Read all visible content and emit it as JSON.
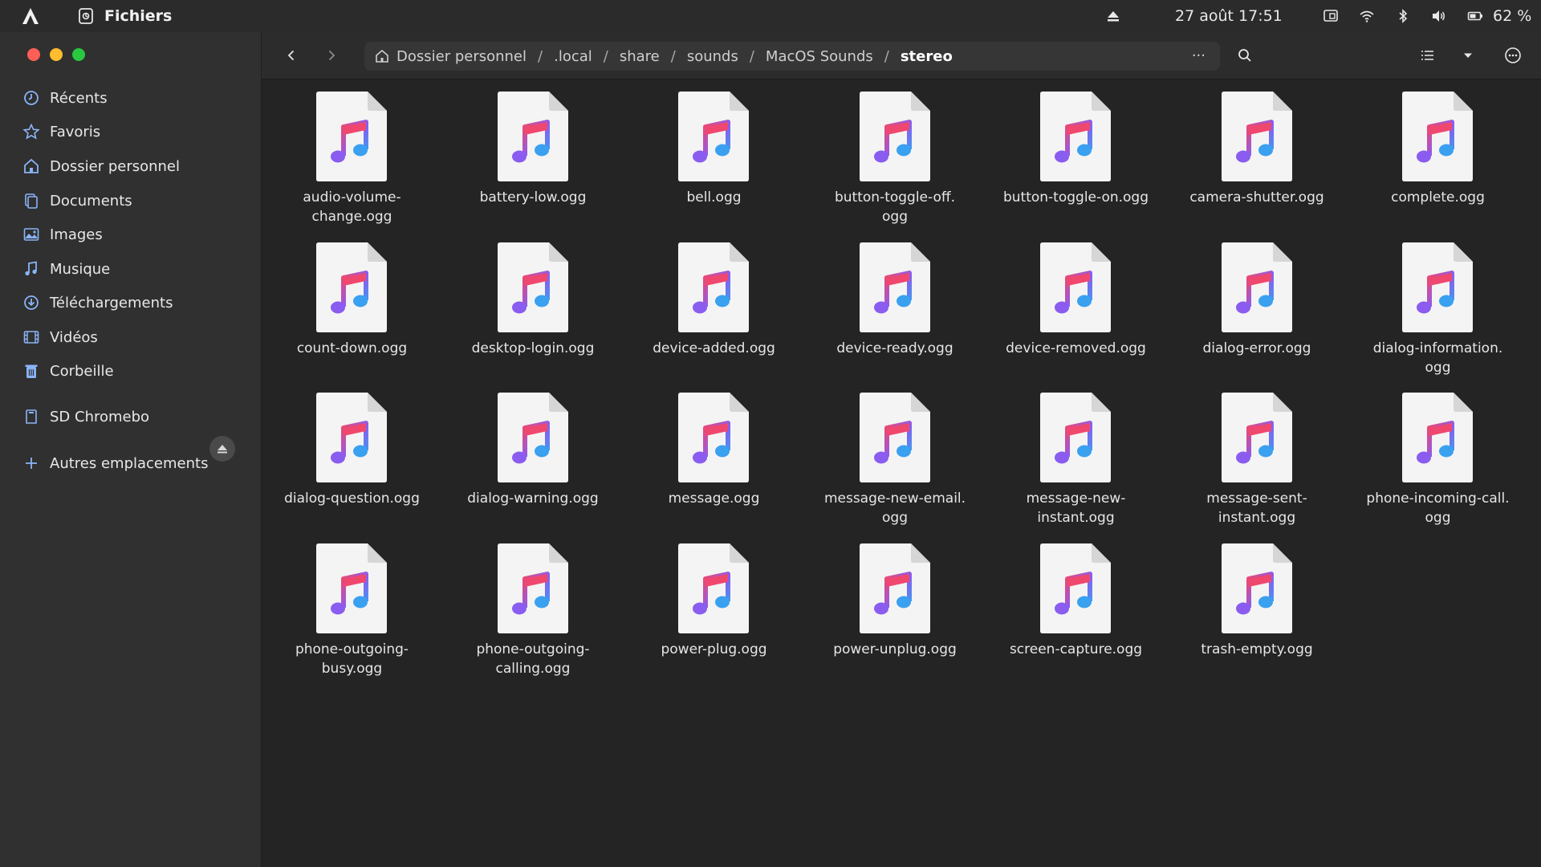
{
  "topbar": {
    "app_name": "Fichiers",
    "clock": "27 août  17:51",
    "battery": "62 %"
  },
  "sidebar": {
    "items": [
      {
        "label": "Récents",
        "icon": "clock-icon"
      },
      {
        "label": "Favoris",
        "icon": "star-icon"
      },
      {
        "label": "Dossier personnel",
        "icon": "home-icon"
      },
      {
        "label": "Documents",
        "icon": "document-icon"
      },
      {
        "label": "Images",
        "icon": "image-icon"
      },
      {
        "label": "Musique",
        "icon": "music-icon"
      },
      {
        "label": "Téléchargements",
        "icon": "download-icon"
      },
      {
        "label": "Vidéos",
        "icon": "film-icon"
      },
      {
        "label": "Corbeille",
        "icon": "trash-icon"
      }
    ],
    "device": {
      "label": "SD Chromebo",
      "icon": "sd-card-icon"
    },
    "other": {
      "label": "Autres emplacements",
      "icon": "plus-icon"
    }
  },
  "breadcrumb": [
    "Dossier personnel",
    ".local",
    "share",
    "sounds",
    "MacOS Sounds",
    "stereo"
  ],
  "breadcrumb_more": "···",
  "files": [
    [
      "audio-volume-",
      "change.ogg"
    ],
    [
      "battery-low.ogg"
    ],
    [
      "bell.ogg"
    ],
    [
      "button-toggle-off.",
      "ogg"
    ],
    [
      "button-toggle-on.ogg"
    ],
    [
      "camera-shutter.ogg"
    ],
    [
      "complete.ogg"
    ],
    [
      "count-down.ogg"
    ],
    [
      "desktop-login.ogg"
    ],
    [
      "device-added.ogg"
    ],
    [
      "device-ready.ogg"
    ],
    [
      "device-removed.ogg"
    ],
    [
      "dialog-error.ogg"
    ],
    [
      "dialog-information.",
      "ogg"
    ],
    [
      "dialog-question.ogg"
    ],
    [
      "dialog-warning.ogg"
    ],
    [
      "message.ogg"
    ],
    [
      "message-new-email.",
      "ogg"
    ],
    [
      "message-new-",
      "instant.ogg"
    ],
    [
      "message-sent-",
      "instant.ogg"
    ],
    [
      "phone-incoming-call.",
      "ogg"
    ],
    [
      "phone-outgoing-",
      "busy.ogg"
    ],
    [
      "phone-outgoing-",
      "calling.ogg"
    ],
    [
      "power-plug.ogg"
    ],
    [
      "power-unplug.ogg"
    ],
    [
      "screen-capture.ogg"
    ],
    [
      "trash-empty.ogg"
    ]
  ],
  "colors": {
    "note_pink": "#f0476e",
    "note_purple": "#8a5cf0",
    "note_blue": "#3aa0f0"
  }
}
